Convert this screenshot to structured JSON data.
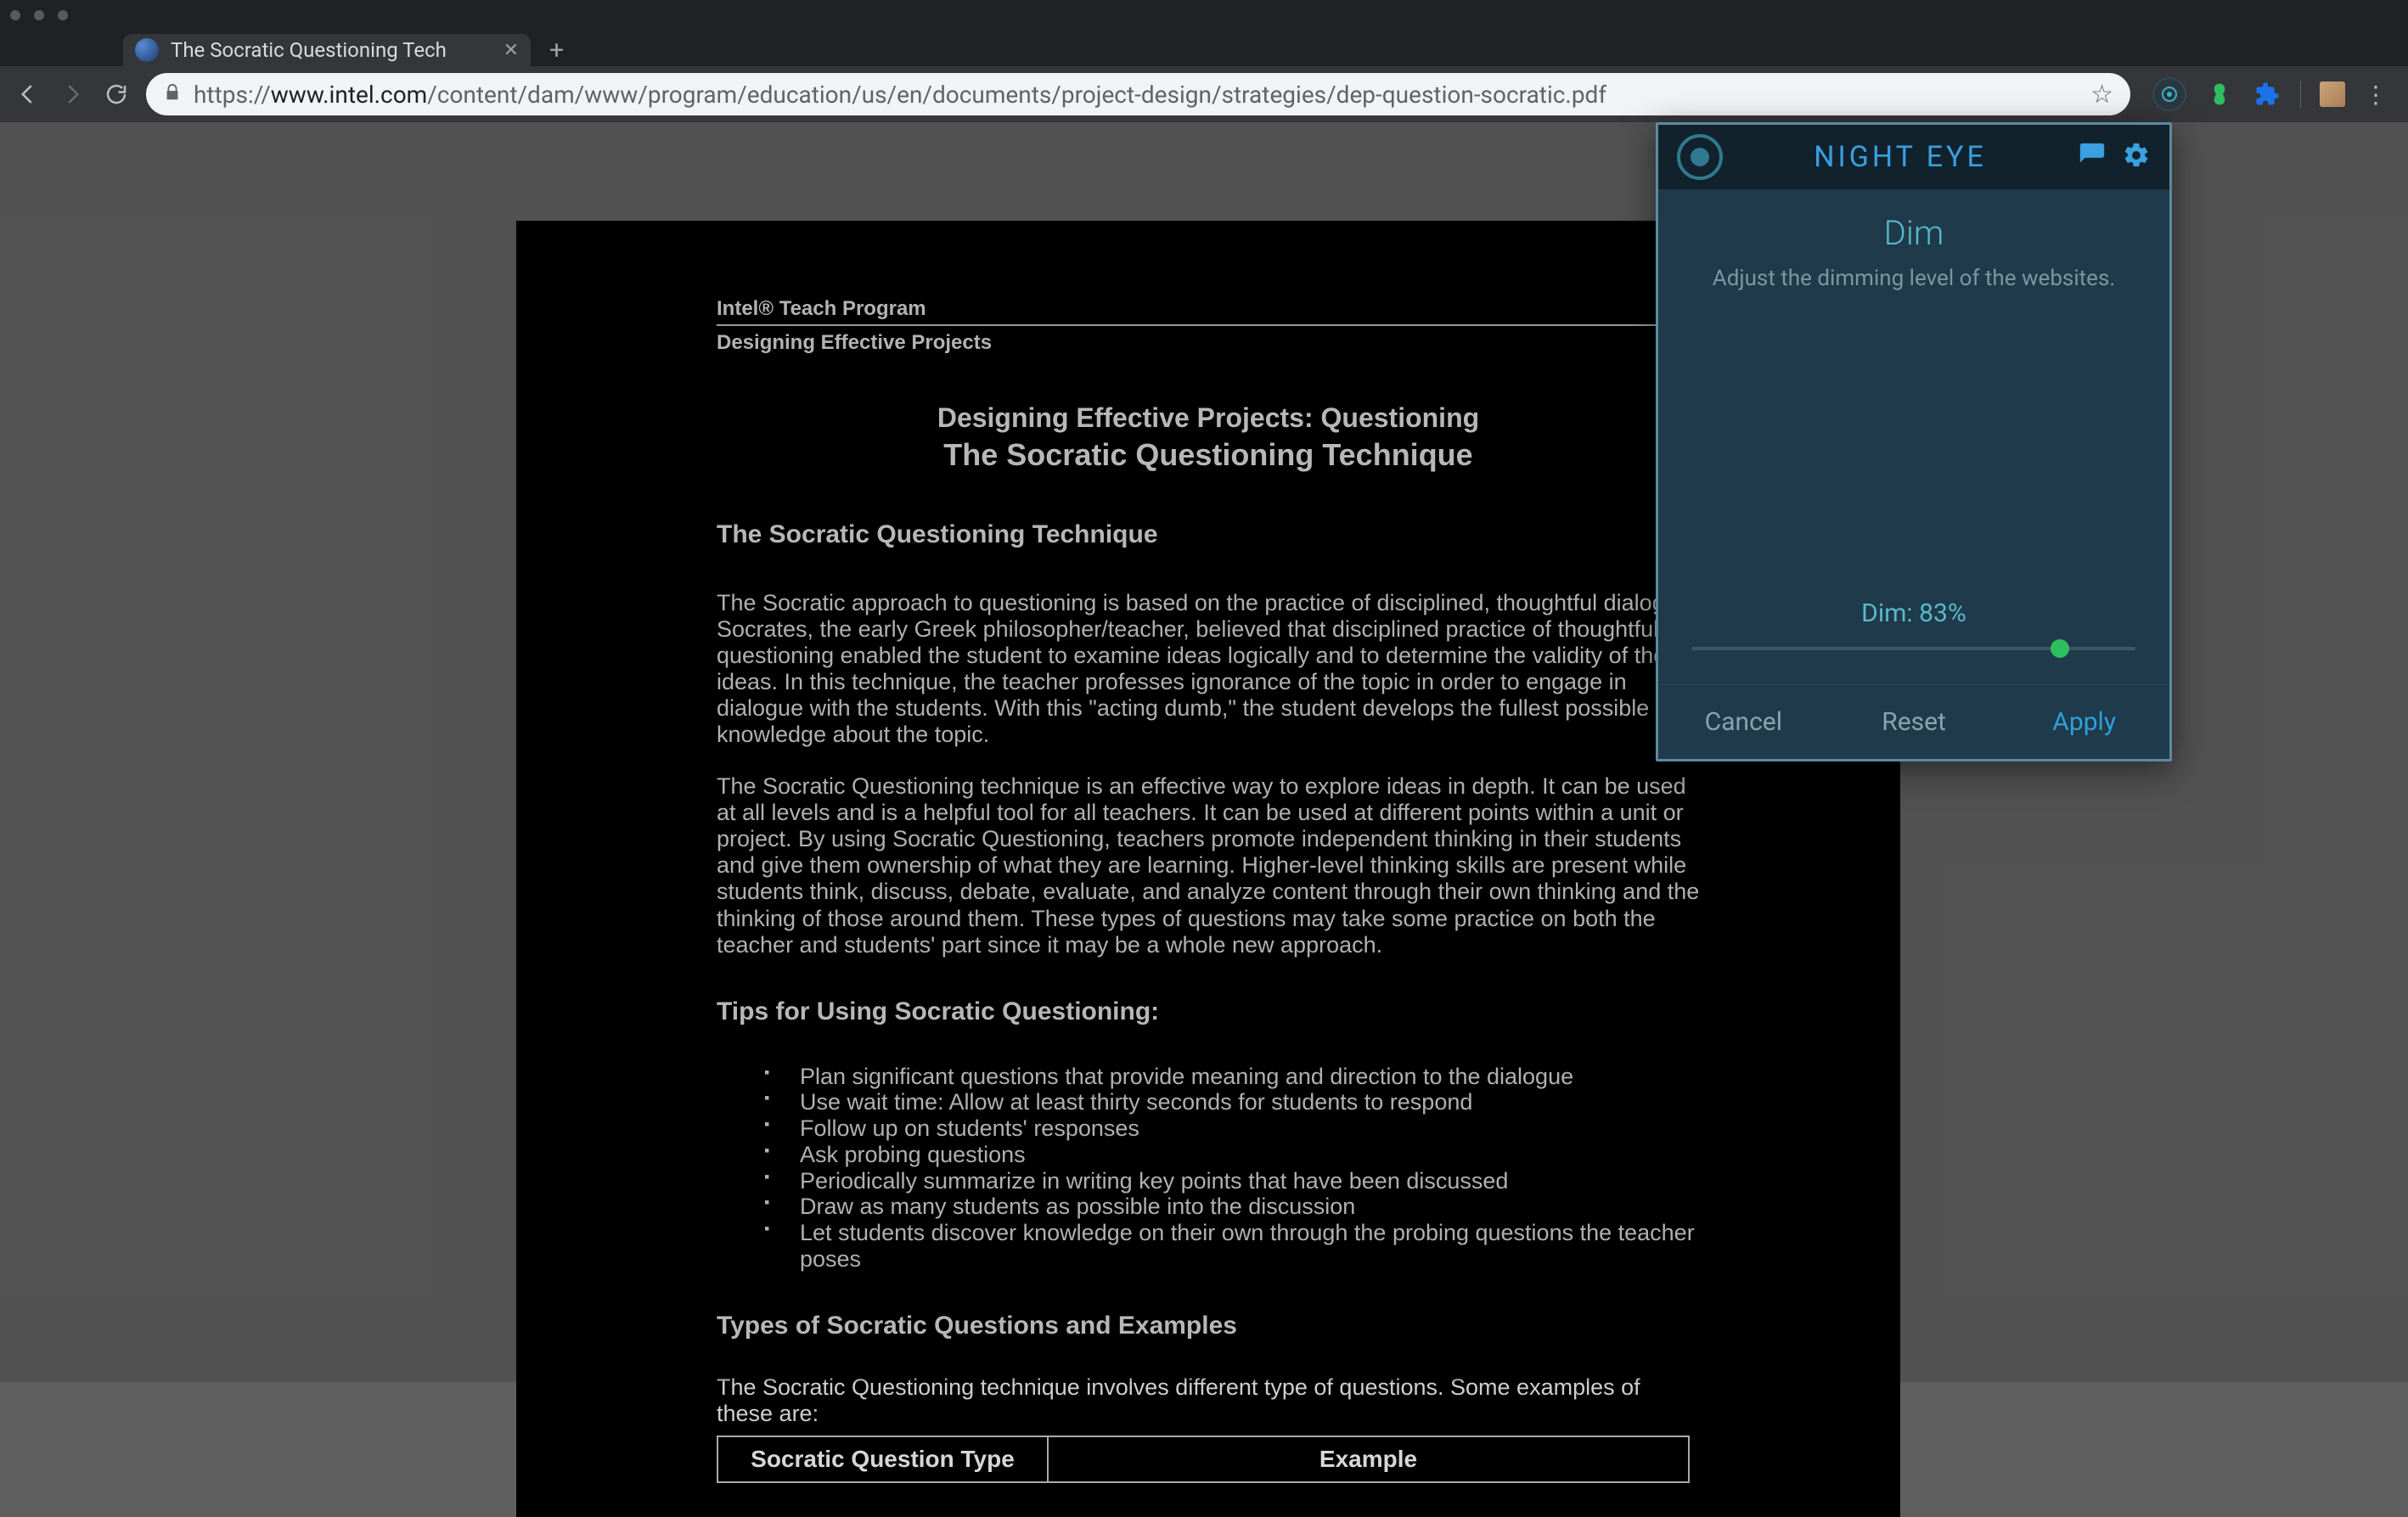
{
  "browser": {
    "tab": {
      "title": "The Socratic Questioning Tech"
    },
    "url": {
      "scheme": "https://",
      "host": "www.intel.com",
      "path": "/content/dam/www/program/education/us/en/documents/project-design/strategies/dep-question-socratic.pdf"
    }
  },
  "pdf": {
    "header1": "Intel® Teach Program",
    "header2": "Designing Effective Projects",
    "title1": "Designing Effective Projects: Questioning",
    "title2": "The Socratic Questioning Technique",
    "h3": "The Socratic Questioning Technique",
    "p1": "The Socratic approach to questioning is based on the practice of disciplined, thoughtful dialogue. Socrates, the early Greek philosopher/teacher, believed that disciplined practice of thoughtful questioning enabled the student to examine ideas logically and to determine the validity of those ideas. In this technique, the teacher professes ignorance of the topic in order to engage in dialogue with the students. With this \"acting dumb,\" the student develops the fullest possible knowledge about the topic.",
    "p2": "The Socratic Questioning technique is an effective way to explore ideas in depth. It can be used at all levels and is a helpful tool for all teachers. It can be used at different points within a unit or project. By using Socratic Questioning, teachers promote independent thinking in their students and give them ownership of what they are learning. Higher-level thinking skills are present while students think, discuss, debate, evaluate, and analyze content through their own thinking and the thinking of those around them. These types of questions may take some practice on both the teacher and students' part since it may be a whole new approach.",
    "h4": "Tips for Using Socratic Questioning:",
    "tips": [
      "Plan significant questions that provide meaning and direction to the dialogue",
      "Use wait time: Allow at least thirty seconds for students to respond",
      "Follow up on students' responses",
      "Ask probing questions",
      "Periodically summarize in writing key points that have been discussed",
      "Draw as many students as possible into the discussion",
      "Let students discover knowledge on their own through the probing questions the teacher poses"
    ],
    "h5": "Types of Socratic Questions and Examples",
    "lead": "The Socratic Questioning technique involves different type of questions. Some examples of these are:",
    "table": {
      "col1": "Socratic Question Type",
      "col2": "Example"
    }
  },
  "popup": {
    "brand": "NIGHT EYE",
    "section_title": "Dim",
    "section_desc": "Adjust the dimming level of the websites.",
    "slider_label_prefix": "Dim: ",
    "slider_value": "83%",
    "slider_pct": 83,
    "buttons": {
      "cancel": "Cancel",
      "reset": "Reset",
      "apply": "Apply"
    }
  }
}
